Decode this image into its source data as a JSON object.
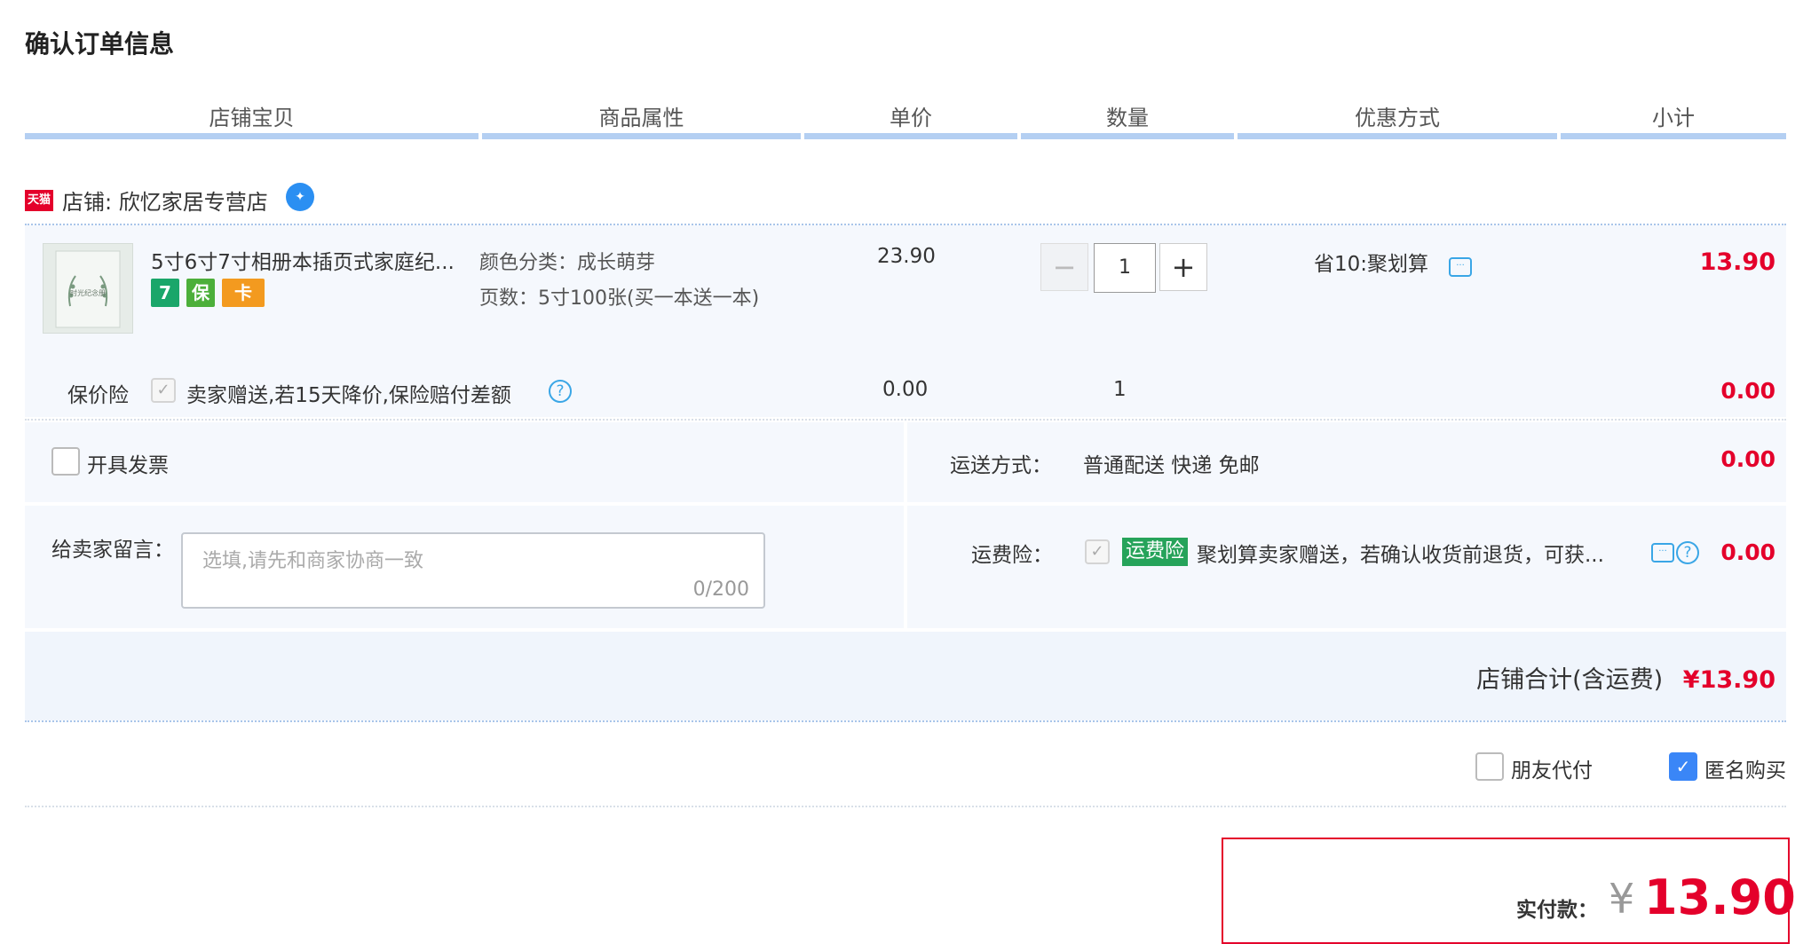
{
  "page": {
    "title": "确认订单信息"
  },
  "columns": [
    "店铺宝贝",
    "商品属性",
    "单价",
    "数量",
    "优惠方式",
    "小计"
  ],
  "shop": {
    "badge": "天猫",
    "label": "店铺: 欣忆家居专营店"
  },
  "item": {
    "title": "5寸6寸7寸相册本插页式家庭纪...",
    "thumb_text": "时光纪念册",
    "service_badges": [
      "7",
      "保",
      "卡"
    ],
    "attributes": [
      "颜色分类：成长萌芽",
      "页数：5寸100张(买一本送一本)"
    ],
    "unit_price": "23.90",
    "quantity": "1",
    "minus": "−",
    "plus": "+",
    "discount": "省10:聚划算",
    "subtotal": "13.90"
  },
  "price_protect": {
    "label": "保价险",
    "checked": true,
    "text": "卖家赠送,若15天降价,保险赔付差额",
    "help": "?",
    "price": "0.00",
    "qty": "1",
    "subtotal": "0.00"
  },
  "invoice": {
    "label": "开具发票",
    "checked": false
  },
  "shipping": {
    "label": "运送方式：",
    "value": "普通配送 快递 免邮",
    "cost": "0.00"
  },
  "message": {
    "label": "给卖家留言：",
    "placeholder": "选填,请先和商家协商一致",
    "counter": "0/200"
  },
  "freight_insurance": {
    "label": "运费险：",
    "tag": "运费险",
    "text": "聚划算卖家赠送，若确认收货前退货，可获...",
    "cost": "0.00"
  },
  "shop_total": {
    "label": "店铺合计(含运费)",
    "value": "¥13.90"
  },
  "options": {
    "friend_pay": "朋友代付",
    "anonymous": "匿名购买",
    "anonymous_checked": true
  },
  "payment": {
    "label": "实付款：",
    "currency": "¥",
    "amount": "13.90"
  },
  "colors": {
    "accent_red": "#e4002b",
    "header_line": "#b4cff2",
    "panel_bg": "#f5f8fd"
  }
}
